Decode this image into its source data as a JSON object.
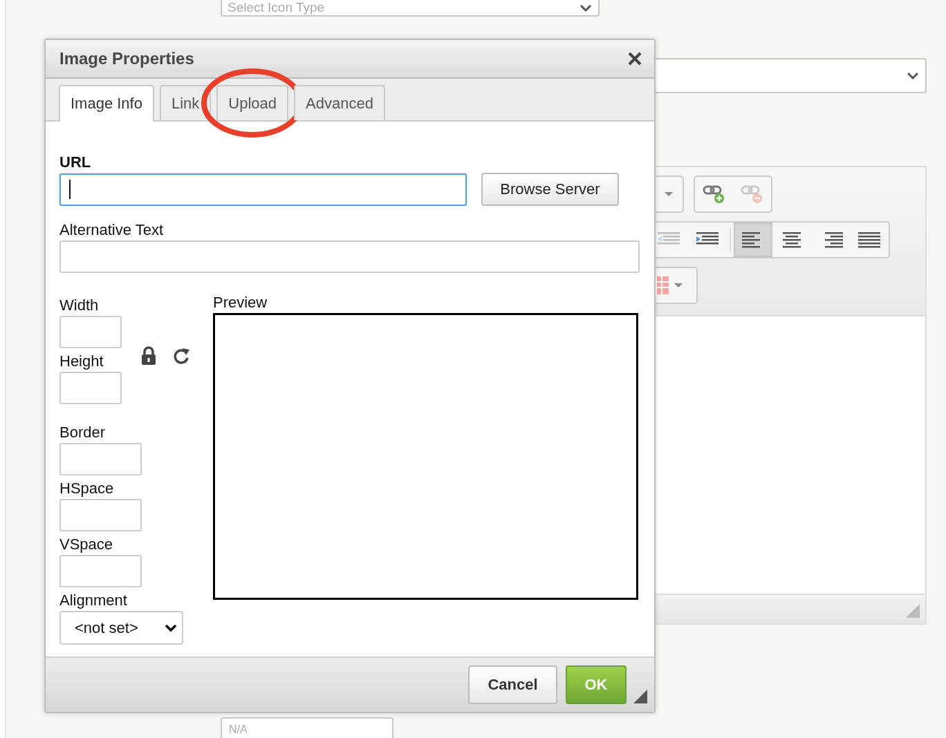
{
  "background": {
    "top_select": {
      "placeholder": "Select Icon Type"
    },
    "toolbar_rows": [
      {
        "groups": [
          [
            {
              "kind": "dropdown"
            }
          ],
          [
            {
              "kind": "link"
            },
            {
              "kind": "unlink",
              "disabled": true
            }
          ]
        ]
      },
      {
        "groups": [
          [
            {
              "kind": "outdent",
              "disabled": true
            },
            {
              "kind": "indent"
            },
            {
              "kind": "separator"
            },
            {
              "kind": "align-left",
              "active": true
            },
            {
              "kind": "align-center"
            },
            {
              "kind": "align-right"
            },
            {
              "kind": "justify"
            }
          ]
        ]
      },
      {
        "groups": [
          [
            {
              "kind": "table"
            }
          ]
        ]
      }
    ],
    "bottom_field": {
      "placeholder": "N/A"
    }
  },
  "dialog": {
    "title": "Image Properties",
    "tabs": [
      {
        "label": "Image Info",
        "selected": true,
        "circled": false
      },
      {
        "label": "Link",
        "selected": false,
        "circled": false
      },
      {
        "label": "Upload",
        "selected": false,
        "circled": true
      },
      {
        "label": "Advanced",
        "selected": false,
        "circled": false
      }
    ],
    "url": {
      "label": "URL",
      "focused": true
    },
    "browse_button": "Browse Server",
    "alt_text": {
      "label": "Alternative Text"
    },
    "size_fields": [
      {
        "label": "Width"
      },
      {
        "label": "Height"
      }
    ],
    "spacing_fields": [
      {
        "label": "Border"
      },
      {
        "label": "HSpace"
      },
      {
        "label": "VSpace"
      }
    ],
    "alignment": {
      "label": "Alignment",
      "value": "<not set>"
    },
    "preview": {
      "label": "Preview"
    },
    "buttons": [
      {
        "label": "Cancel",
        "kind": "secondary"
      },
      {
        "label": "OK",
        "kind": "primary"
      }
    ]
  }
}
